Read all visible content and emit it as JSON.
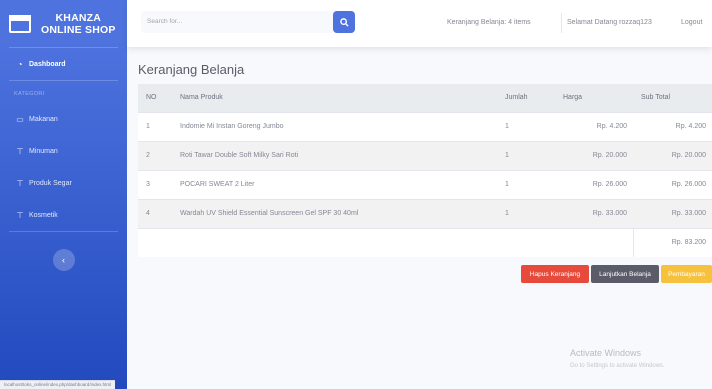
{
  "sidebar": {
    "brand_line1": "KHANZA",
    "brand_line2": "ONLINE SHOP",
    "dashboard_label": "Dashboard",
    "heading": "KATEGORI",
    "items": [
      {
        "label": "Makanan",
        "icon": "monitor-icon"
      },
      {
        "label": "Minuman",
        "icon": "tag-icon"
      },
      {
        "label": "Produk Segar",
        "icon": "tag-icon"
      },
      {
        "label": "Kosmetik",
        "icon": "tag-icon"
      }
    ],
    "toggle_icon": "‹"
  },
  "topbar": {
    "search_placeholder": "Search for...",
    "cart_status": "Keranjang Belanja: 4 items",
    "greeting": "Selamat Datang rozzaq123",
    "logout": "Logout"
  },
  "main": {
    "title": "Keranjang Belanja",
    "columns": [
      "NO",
      "Nama Produk",
      "Jumlah",
      "Harga",
      "Sub Total"
    ],
    "rows": [
      {
        "no": "1",
        "name": "Indomie Mi Instan Goreng Jumbo",
        "qty": "1",
        "price": "Rp. 4.200",
        "subtotal": "Rp. 4.200"
      },
      {
        "no": "2",
        "name": "Roti Tawar Double Soft Milky Sari Roti",
        "qty": "1",
        "price": "Rp. 20.000",
        "subtotal": "Rp. 20.000"
      },
      {
        "no": "3",
        "name": "POCARI SWEAT 2 Liter",
        "qty": "1",
        "price": "Rp. 26.000",
        "subtotal": "Rp. 26.000"
      },
      {
        "no": "4",
        "name": "Wardah UV Shield Essential Sunscreen Gel SPF 30 40ml",
        "qty": "1",
        "price": "Rp. 33.000",
        "subtotal": "Rp. 33.000"
      }
    ],
    "total": "Rp. 83.200",
    "buttons": {
      "clear": "Hapus Keranjang",
      "continue": "Lanjutkan Belanja",
      "pay": "Pembayaran"
    }
  },
  "windows_watermark": {
    "line1": "Activate Windows",
    "line2": "Go to Settings to activate Windows."
  },
  "status_url": "localhost/toko_online/index.php/dashboard/index.html",
  "colors": {
    "sidebar": "#4e73df",
    "danger": "#e74a3b",
    "secondary": "#5a5c69",
    "warning": "#f6c23e"
  }
}
